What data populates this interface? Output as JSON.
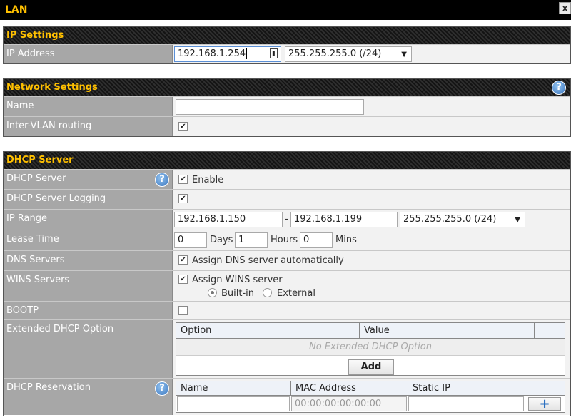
{
  "window": {
    "title": "LAN",
    "close_glyph": "x"
  },
  "ip_settings": {
    "header": "IP Settings",
    "ip_address_label": "IP Address",
    "ip_address_value": "192.168.1.254",
    "subnet_mask": "255.255.255.0 (/24)"
  },
  "network_settings": {
    "header": "Network Settings",
    "name_label": "Name",
    "name_value": "",
    "inter_vlan_label": "Inter-VLAN routing",
    "inter_vlan_checked": true
  },
  "dhcp": {
    "header": "DHCP Server",
    "server_label": "DHCP Server",
    "enable_label": "Enable",
    "logging_label": "DHCP Server Logging",
    "ip_range_label": "IP Range",
    "range_start": "192.168.1.150",
    "range_sep": "-",
    "range_end": "192.168.1.199",
    "range_mask": "255.255.255.0 (/24)",
    "lease_label": "Lease Time",
    "lease_days": "0",
    "days_label": "Days",
    "lease_hours": "1",
    "hours_label": "Hours",
    "lease_mins": "0",
    "mins_label": "Mins",
    "dns_label": "DNS Servers",
    "dns_auto_label": "Assign DNS server automatically",
    "wins_label": "WINS Servers",
    "wins_assign_label": "Assign WINS server",
    "wins_builtin_label": "Built-in",
    "wins_external_label": "External",
    "bootp_label": "BOOTP",
    "ext_option_label": "Extended DHCP Option",
    "ext_col_option": "Option",
    "ext_col_value": "Value",
    "ext_empty": "No Extended DHCP Option",
    "ext_add_button": "Add",
    "reservation_label": "DHCP Reservation",
    "res_col_name": "Name",
    "res_col_mac": "MAC Address",
    "res_col_ip": "Static IP",
    "res_mac_placeholder": "00:00:00:00:00:00",
    "res_add_glyph": "+"
  },
  "help_glyph": "?",
  "check_glyph": "✔",
  "select_arrow": "▼",
  "colors": {
    "header_text": "#ffc000",
    "label_bg": "#a7a7a7",
    "value_bg": "#f2f2f2",
    "help_blue": "#3d78c0"
  }
}
